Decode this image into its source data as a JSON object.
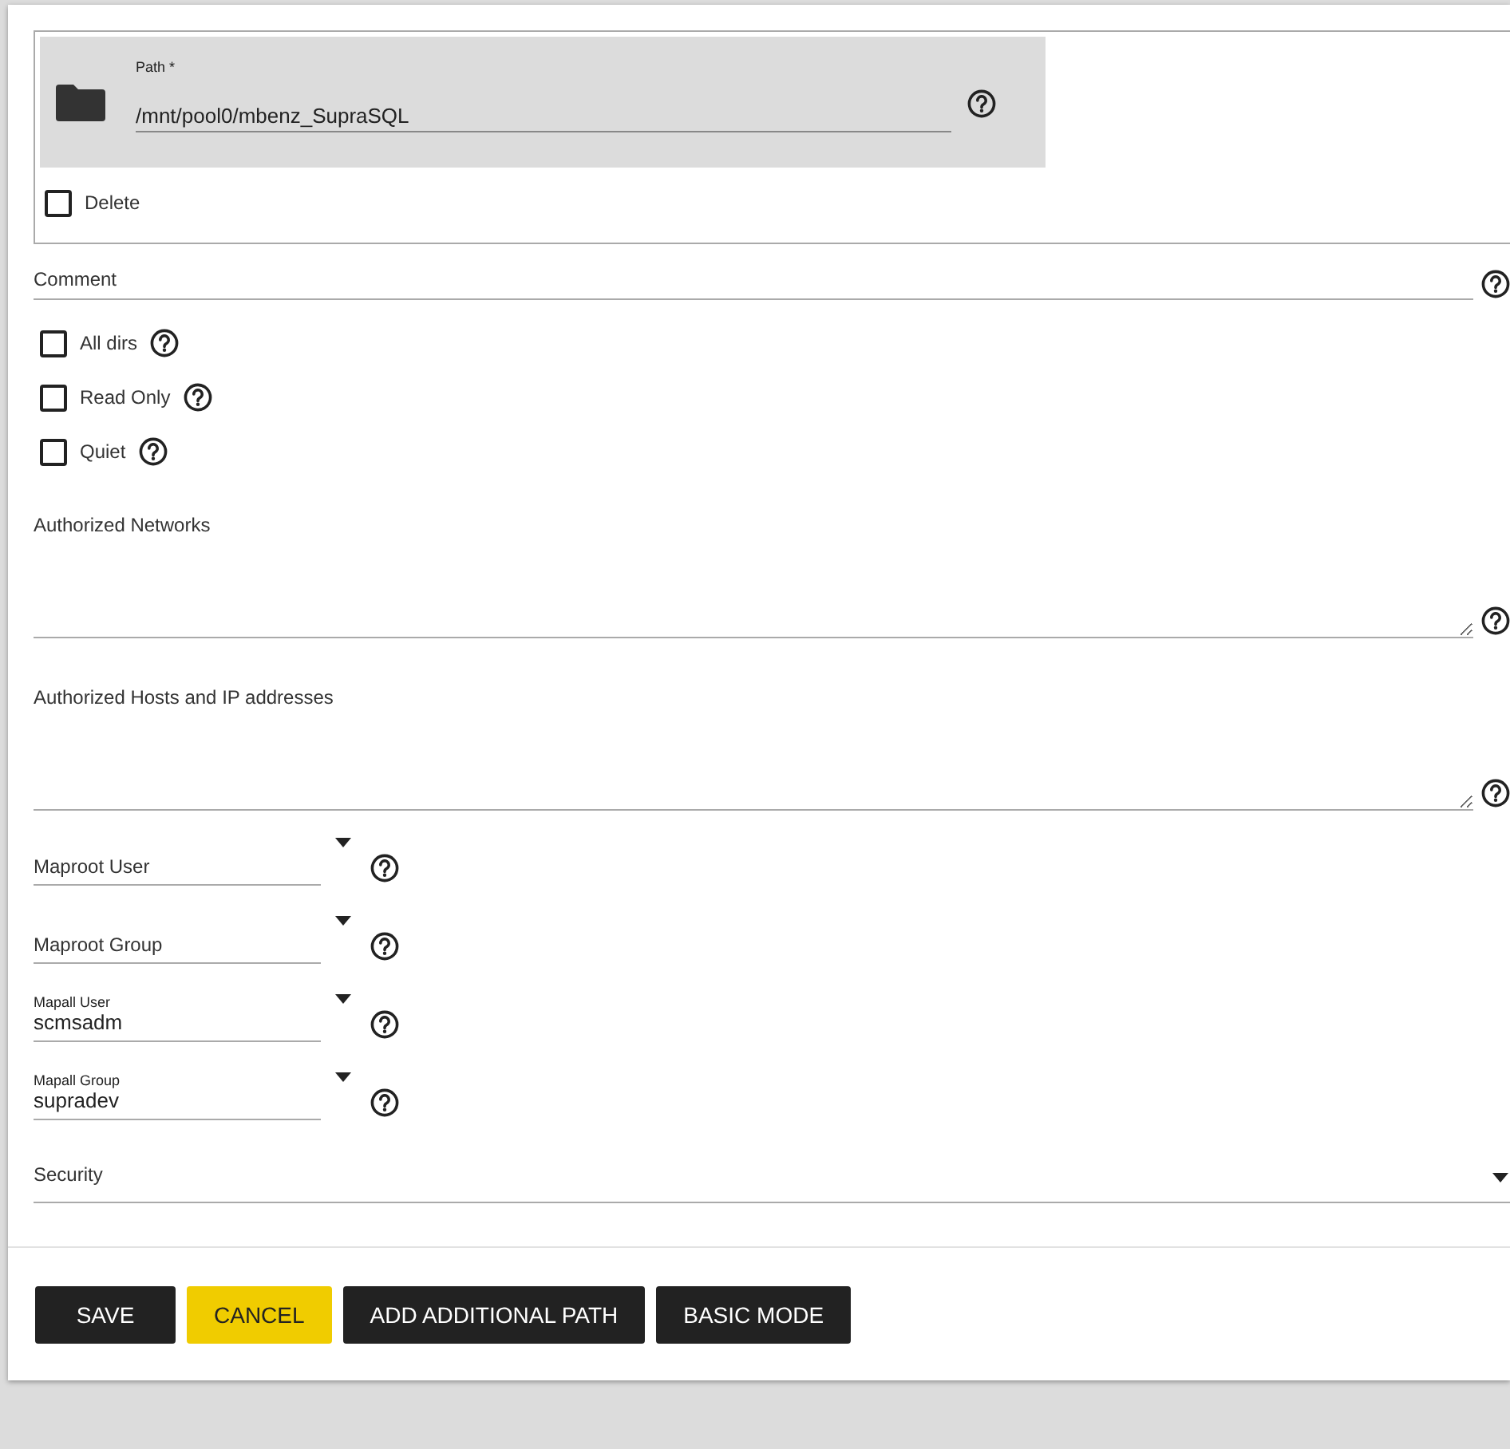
{
  "path_group": {
    "path": {
      "label": "Path *",
      "value": "/mnt/pool0/mbenz_SupraSQL"
    },
    "delete": {
      "label": "Delete",
      "checked": false
    }
  },
  "comment": {
    "placeholder": "Comment"
  },
  "options": [
    {
      "label": "All dirs",
      "checked": false
    },
    {
      "label": "Read Only",
      "checked": false
    },
    {
      "label": "Quiet",
      "checked": false
    }
  ],
  "textareas": [
    {
      "placeholder": "Authorized Networks"
    },
    {
      "placeholder": "Authorized Hosts and IP addresses"
    }
  ],
  "selects": [
    {
      "label": "Maproot User"
    },
    {
      "label": "Maproot Group"
    },
    {
      "label": "Mapall User",
      "value": "scmsadm"
    },
    {
      "label": "Mapall Group",
      "value": "supradev"
    }
  ],
  "security": {
    "label": "Security"
  },
  "buttons": [
    {
      "label": "SAVE",
      "kind": "dark"
    },
    {
      "label": "CANCEL",
      "kind": "accent"
    },
    {
      "label": "ADD ADDITIONAL PATH",
      "kind": "dark"
    },
    {
      "label": "BASIC MODE",
      "kind": "dark"
    }
  ]
}
